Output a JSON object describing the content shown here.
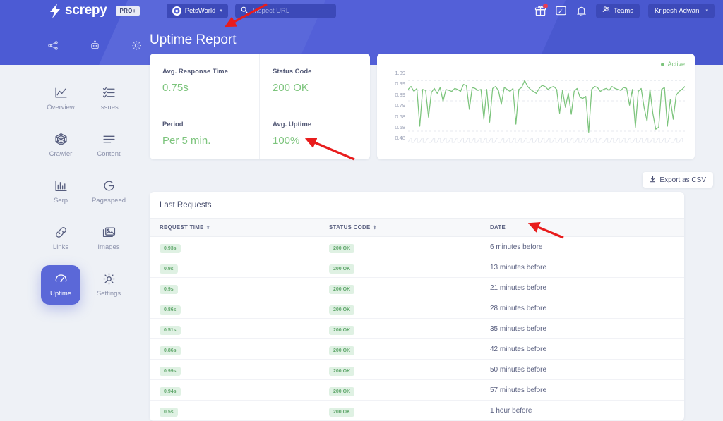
{
  "brand": {
    "name": "screpy",
    "badge": "PRO+",
    "logo_icon": "lightning-bolt-icon"
  },
  "topbar": {
    "site_selector": {
      "label": "PetsWorld",
      "avatar_icon": "site-avatar-icon",
      "caret_icon": "chevron-down-icon"
    },
    "search": {
      "placeholder": "Inspect URL",
      "icon": "search-icon"
    },
    "icons": [
      {
        "name": "gift-icon",
        "badge": true
      },
      {
        "name": "feedback-icon",
        "badge": false
      },
      {
        "name": "bell-icon",
        "badge": false
      }
    ],
    "teams_label": "Teams",
    "teams_icon": "people-icon",
    "user_label": "Kripesh Adwani",
    "user_caret": "chevron-down-icon"
  },
  "subnav_icons": [
    "sitemap-icon",
    "robot-icon",
    "gear-icon"
  ],
  "page_title": "Uptime Report",
  "sidebar": {
    "items": [
      {
        "label": "Overview",
        "icon": "chart-line-icon",
        "active": false
      },
      {
        "label": "Issues",
        "icon": "checklist-icon",
        "active": false
      },
      {
        "label": "Crawler",
        "icon": "spider-web-icon",
        "active": false
      },
      {
        "label": "Content",
        "icon": "text-lines-icon",
        "active": false
      },
      {
        "label": "Serp",
        "icon": "bar-chart-icon",
        "active": false
      },
      {
        "label": "Pagespeed",
        "icon": "google-g-icon",
        "active": false
      },
      {
        "label": "Links",
        "icon": "link-icon",
        "active": false
      },
      {
        "label": "Images",
        "icon": "images-icon",
        "active": false
      },
      {
        "label": "Uptime",
        "icon": "speedometer-icon",
        "active": true
      },
      {
        "label": "Settings",
        "icon": "gear-icon",
        "active": false
      }
    ]
  },
  "stats": [
    {
      "label": "Avg. Response Time",
      "value": "0.75s"
    },
    {
      "label": "Status Code",
      "value": "200 OK"
    },
    {
      "label": "Period",
      "value": "Per 5 min."
    },
    {
      "label": "Avg. Uptime",
      "value": "100%"
    }
  ],
  "colors": {
    "brand_purple": "#4c5bd4",
    "accent_green": "#7cc47c",
    "pill_bg": "#dff1e3",
    "page_bg": "#eef1f6"
  },
  "chart_data": {
    "type": "line",
    "title": "",
    "xlabel": "",
    "ylabel": "",
    "legend": [
      {
        "name": "Active",
        "color": "#7cc47c"
      }
    ],
    "legend_position": "top-right",
    "grid": true,
    "ylim": [
      0.48,
      1.09
    ],
    "yticks": [
      "1.09",
      "0.99",
      "0.89",
      "0.79",
      "0.68",
      "0.58",
      "0.48"
    ],
    "series": [
      {
        "name": "Active",
        "values": [
          0.9,
          0.93,
          0.88,
          0.91,
          0.53,
          0.9,
          0.89,
          0.62,
          0.87,
          0.91,
          0.86,
          0.92,
          0.78,
          0.9,
          0.89,
          0.88,
          0.91,
          0.9,
          0.88,
          0.95,
          0.94,
          0.7,
          0.92,
          0.91,
          0.89,
          0.9,
          0.6,
          0.9,
          0.57,
          0.91,
          0.93,
          0.89,
          0.75,
          0.92,
          0.9,
          0.88,
          0.91,
          0.55,
          0.9,
          0.92,
          0.99,
          0.93,
          0.9,
          0.88,
          0.86,
          0.91,
          0.94,
          0.93,
          0.9,
          0.92,
          0.93,
          0.9,
          0.66,
          0.89,
          0.72,
          0.86,
          0.65,
          0.88,
          0.91,
          0.82,
          0.81,
          0.83,
          0.47,
          0.9,
          0.93,
          0.92,
          0.88,
          0.9,
          0.91,
          0.89,
          0.93,
          0.91,
          0.9,
          0.89,
          0.92,
          0.91,
          0.74,
          0.9,
          0.52,
          0.88,
          0.91,
          0.72,
          0.58,
          0.9,
          0.66,
          0.5,
          0.52,
          0.9,
          0.92,
          0.53,
          0.8,
          0.6,
          0.84,
          0.88,
          0.9,
          0.93
        ]
      }
    ]
  },
  "export": {
    "label": "Export as CSV",
    "icon": "download-icon"
  },
  "table": {
    "title": "Last Requests",
    "columns": [
      {
        "label": "REQUEST TIME",
        "sortable": true
      },
      {
        "label": "STATUS CODE",
        "sortable": true
      },
      {
        "label": "DATE",
        "sortable": false
      }
    ],
    "rows": [
      {
        "request_time": "0.93s",
        "status_code": "200 OK",
        "date": "6 minutes before"
      },
      {
        "request_time": "0.9s",
        "status_code": "200 OK",
        "date": "13 minutes before"
      },
      {
        "request_time": "0.9s",
        "status_code": "200 OK",
        "date": "21 minutes before"
      },
      {
        "request_time": "0.86s",
        "status_code": "200 OK",
        "date": "28 minutes before"
      },
      {
        "request_time": "0.51s",
        "status_code": "200 OK",
        "date": "35 minutes before"
      },
      {
        "request_time": "0.86s",
        "status_code": "200 OK",
        "date": "42 minutes before"
      },
      {
        "request_time": "0.99s",
        "status_code": "200 OK",
        "date": "50 minutes before"
      },
      {
        "request_time": "0.94s",
        "status_code": "200 OK",
        "date": "57 minutes before"
      },
      {
        "request_time": "0.5s",
        "status_code": "200 OK",
        "date": "1 hour before"
      }
    ]
  },
  "annotations": [
    {
      "name": "arrow-to-avg-response-time",
      "x1": 378,
      "y1": 6,
      "x2": 318,
      "y2": 38
    },
    {
      "name": "arrow-to-avg-uptime",
      "x1": 500,
      "y1": 36,
      "x2": 428,
      "y2": 8
    },
    {
      "name": "arrow-to-first-date",
      "x1": 790,
      "y1": 35,
      "x2": 752,
      "y2": 8
    }
  ]
}
